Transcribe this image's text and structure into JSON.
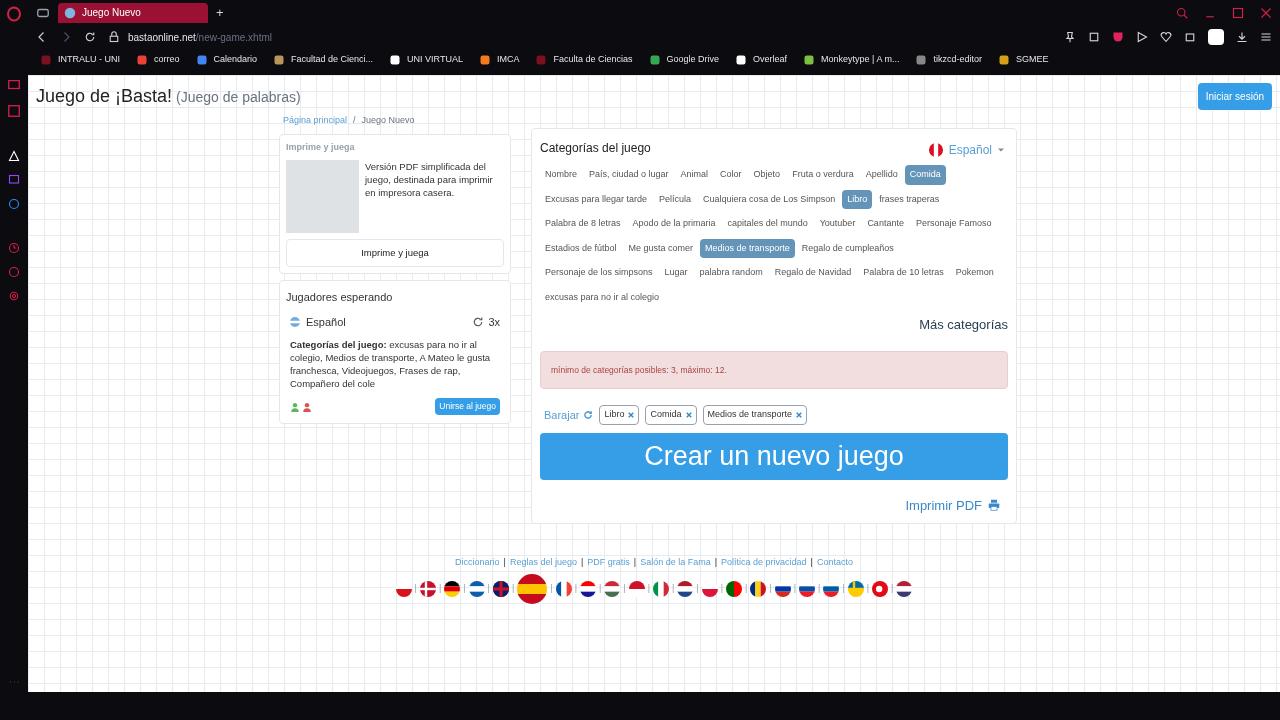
{
  "browser": {
    "tab": {
      "title": "Juego Nuevo",
      "selected": true
    },
    "new_tab": "+",
    "url_host": "bastaonline.net",
    "url_path": "/new-game.xhtml",
    "bookmarks": [
      "INTRALU - UNI",
      "correo",
      "Calendario",
      "Facultad de Cienci...",
      "UNI VIRTUAL",
      "IMCA",
      "Faculta de Ciencias",
      "Google Drive",
      "Overleaf",
      "Monkeytype | A m...",
      "tikzcd-editor",
      "SGMEE"
    ]
  },
  "header": {
    "title": "Juego de ¡Basta!",
    "subtitle": "(Juego de palabras)",
    "login": "Iniciar sesión"
  },
  "breadcrumb": [
    "Página principal",
    "Juego Nuevo"
  ],
  "breadcrumb_separator": "/",
  "print_card": {
    "heading": "Imprime y juega",
    "description": "Versión PDF simplificada del juego, destinada para imprimir en impresora casera.",
    "button": "Imprime y juega"
  },
  "waiting": {
    "heading": "Jugadores esperando",
    "language": "Español",
    "rounds": "3x",
    "categories": "**Categorías del juego:** excusas para no ir al colegio, Medios de transporte, A Mateo le gusta franchesca, Videojuegos, Frases de rap, Compañero del cole",
    "players": [
      {
        "color": "#5cb85c"
      },
      {
        "color": "#d9534f"
      }
    ],
    "join": "Unirse al juego"
  },
  "categories_panel": {
    "heading": "Categorías del juego",
    "language": "Español",
    "categories": [
      {
        "label": "Nombre",
        "selected": false
      },
      {
        "label": "País, ciudad o lugar",
        "selected": false
      },
      {
        "label": "Animal",
        "selected": false
      },
      {
        "label": "Color",
        "selected": false
      },
      {
        "label": "Objeto",
        "selected": false
      },
      {
        "label": "Fruta o verdura",
        "selected": false
      },
      {
        "label": "Apellido",
        "selected": false
      },
      {
        "label": "Comida",
        "selected": true
      },
      {
        "label": "Excusas para llegar tarde",
        "selected": false
      },
      {
        "label": "Película",
        "selected": false
      },
      {
        "label": "Cualquiera cosa de Los Simpson",
        "selected": false
      },
      {
        "label": "Libro",
        "selected": true
      },
      {
        "label": "frases traperas",
        "selected": false
      },
      {
        "label": "Palabra de 8 letras",
        "selected": false
      },
      {
        "label": "Apodo de la primaria",
        "selected": false
      },
      {
        "label": "capitales del mundo",
        "selected": false
      },
      {
        "label": "Youtuber",
        "selected": false
      },
      {
        "label": "Cantante",
        "selected": false
      },
      {
        "label": "Personaje Famoso",
        "selected": false
      },
      {
        "label": "Estadios de fútbol",
        "selected": false
      },
      {
        "label": "Me gusta comer",
        "selected": false
      },
      {
        "label": "Medios de transporte",
        "selected": true
      },
      {
        "label": "Regalo de cumpleaños",
        "selected": false
      },
      {
        "label": "Personaje de los simpsons",
        "selected": false
      },
      {
        "label": "Lugar",
        "selected": false
      },
      {
        "label": "palabra random",
        "selected": false
      },
      {
        "label": "Regalo de Navidad",
        "selected": false
      },
      {
        "label": "Palabra de 10 letras",
        "selected": false
      },
      {
        "label": "Pokemon",
        "selected": false
      },
      {
        "label": "excusas para no ir al colegio",
        "selected": false
      }
    ],
    "more": "Más categorías",
    "alert": "mínimo de categorías posibles: 3, máximo: 12.",
    "shuffle": "Barajar",
    "chosen": [
      "Libro",
      "Comida",
      "Medios de transporte"
    ],
    "create": "Crear un nuevo juego",
    "print_pdf": "Imprimir PDF"
  },
  "footer": {
    "links": [
      "Diccionario",
      "Reglas del juego",
      "PDF gratis",
      "Salón de la Fama",
      "Política de privacidad",
      "Contacto"
    ],
    "link_separators": [
      "|",
      "|",
      "|",
      "|",
      "|"
    ],
    "flags": [
      {
        "kind": "cz",
        "selected": false
      },
      {
        "kind": "dk",
        "selected": false
      },
      {
        "kind": "de",
        "selected": false
      },
      {
        "kind": "gr",
        "selected": false
      },
      {
        "kind": "gb",
        "selected": false
      },
      {
        "kind": "es",
        "selected": true
      },
      {
        "kind": "fr",
        "selected": false
      },
      {
        "kind": "hr",
        "selected": false
      },
      {
        "kind": "hu",
        "selected": false
      },
      {
        "kind": "id",
        "selected": false
      },
      {
        "kind": "it",
        "selected": false
      },
      {
        "kind": "nl",
        "selected": false
      },
      {
        "kind": "pl",
        "selected": false
      },
      {
        "kind": "pt",
        "selected": false
      },
      {
        "kind": "ro",
        "selected": false
      },
      {
        "kind": "ru",
        "selected": false
      },
      {
        "kind": "sk",
        "selected": false
      },
      {
        "kind": "si",
        "selected": false
      },
      {
        "kind": "se",
        "selected": false
      },
      {
        "kind": "tr",
        "selected": false
      },
      {
        "kind": "us",
        "selected": false
      }
    ],
    "flag_separators": [
      "|",
      "|",
      "|",
      "|",
      "|",
      "|",
      "|",
      "|",
      "|",
      "|",
      "|",
      "|",
      "|",
      "|",
      "|",
      "|",
      "|",
      "|",
      "|",
      "|"
    ]
  }
}
